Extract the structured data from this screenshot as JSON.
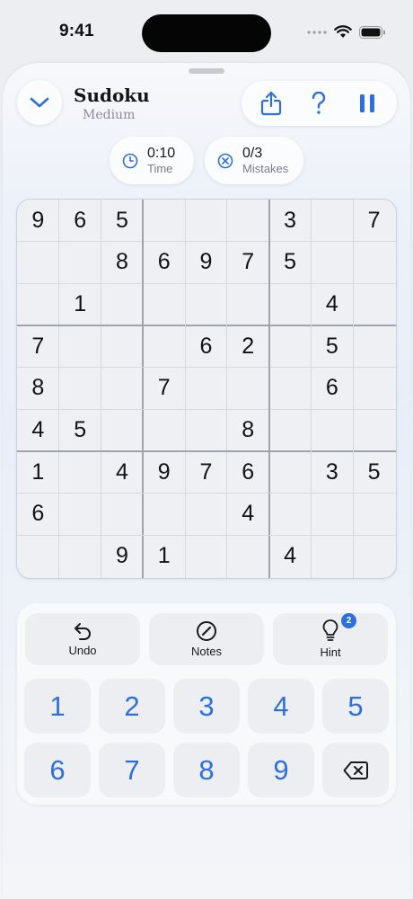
{
  "status": {
    "time": "9:41"
  },
  "header": {
    "title": "Sudoku",
    "difficulty": "Medium"
  },
  "toolbar": {
    "share_icon": "share-icon",
    "help_icon": "question-icon",
    "pause_icon": "pause-icon"
  },
  "stats": {
    "time_value": "0:10",
    "time_label": "Time",
    "mistakes_value": "0/3",
    "mistakes_label": "Mistakes"
  },
  "board": [
    [
      "9",
      "6",
      "5",
      "",
      "",
      "",
      "3",
      "",
      "7"
    ],
    [
      "",
      "",
      "8",
      "6",
      "9",
      "7",
      "5",
      "",
      ""
    ],
    [
      "",
      "1",
      "",
      "",
      "",
      "",
      "",
      "4",
      ""
    ],
    [
      "7",
      "",
      "",
      "",
      "6",
      "2",
      "",
      "5",
      ""
    ],
    [
      "8",
      "",
      "",
      "7",
      "",
      "",
      "",
      "6",
      ""
    ],
    [
      "4",
      "5",
      "",
      "",
      "",
      "8",
      "",
      "",
      ""
    ],
    [
      "1",
      "",
      "4",
      "9",
      "7",
      "6",
      "",
      "3",
      "5"
    ],
    [
      "6",
      "",
      "",
      "",
      "",
      "4",
      "",
      "",
      ""
    ],
    [
      "",
      "",
      "9",
      "1",
      "",
      "",
      "4",
      "",
      ""
    ]
  ],
  "actions": {
    "undo_label": "Undo",
    "notes_label": "Notes",
    "hint_label": "Hint",
    "hint_count": "2"
  },
  "numbers": [
    "1",
    "2",
    "3",
    "4",
    "5",
    "6",
    "7",
    "8",
    "9"
  ],
  "colors": {
    "accent": "#2d6fdc",
    "cell_bg": "#eef0f4",
    "thick_line": "#9fa4ab"
  }
}
